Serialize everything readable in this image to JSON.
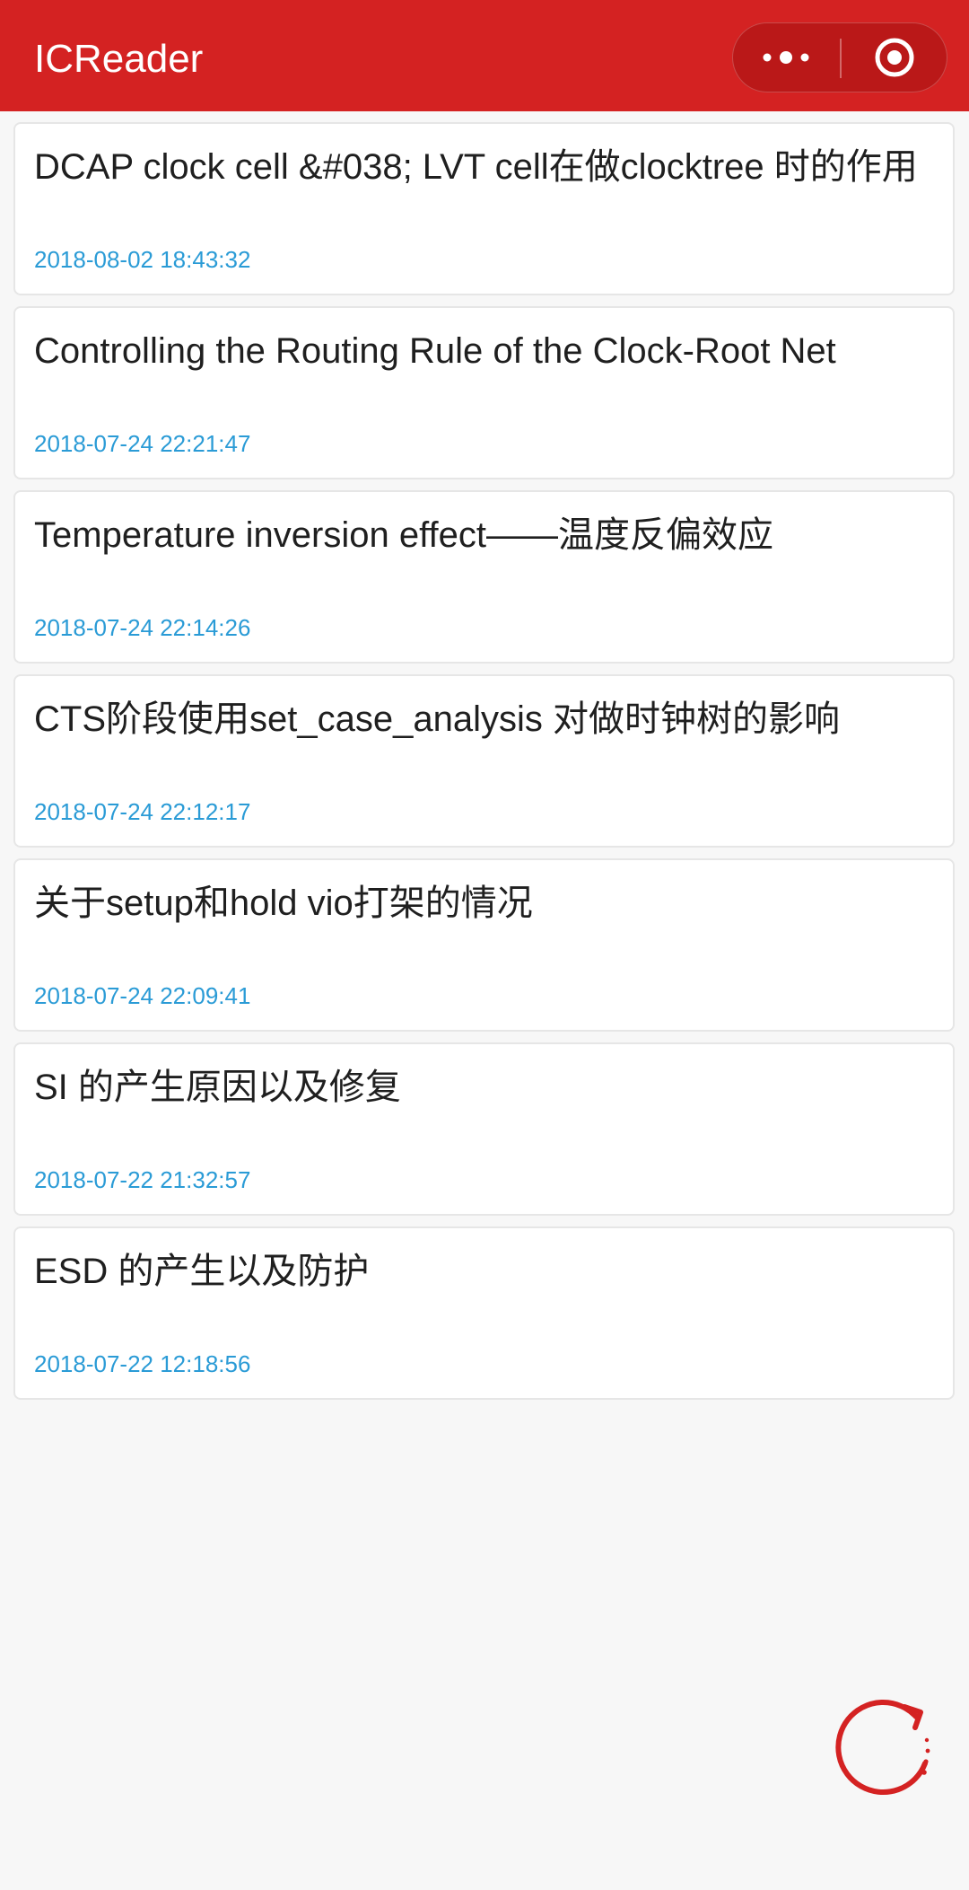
{
  "header": {
    "title": "ICReader",
    "background_color": "#d42222",
    "capsule": {
      "more_icon": "more-dots-icon",
      "close_icon": "target-circle-icon"
    }
  },
  "articles": [
    {
      "title": "DCAP clock cell &#038; LVT cell在做clocktree 时的作用",
      "date": "2018-08-02 18:43:32"
    },
    {
      "title": "Controlling the Routing Rule of the Clock-Root Net",
      "date": "2018-07-24 22:21:47"
    },
    {
      "title": "Temperature inversion effect——温度反偏效应",
      "date": "2018-07-24 22:14:26"
    },
    {
      "title": "CTS阶段使用set_case_analysis 对做时钟树的影响",
      "date": "2018-07-24 22:12:17"
    },
    {
      "title": "关于setup和hold vio打架的情况",
      "date": "2018-07-24 22:09:41"
    },
    {
      "title": "SI 的产生原因以及修复",
      "date": "2018-07-22 21:32:57"
    },
    {
      "title": "ESD 的产生以及防护",
      "date": "2018-07-22 12:18:56"
    }
  ],
  "colors": {
    "accent": "#d42222",
    "date_text": "#2a9bd6",
    "page_background": "#f7f7f7"
  },
  "refresh": {
    "icon": "refresh-icon"
  }
}
